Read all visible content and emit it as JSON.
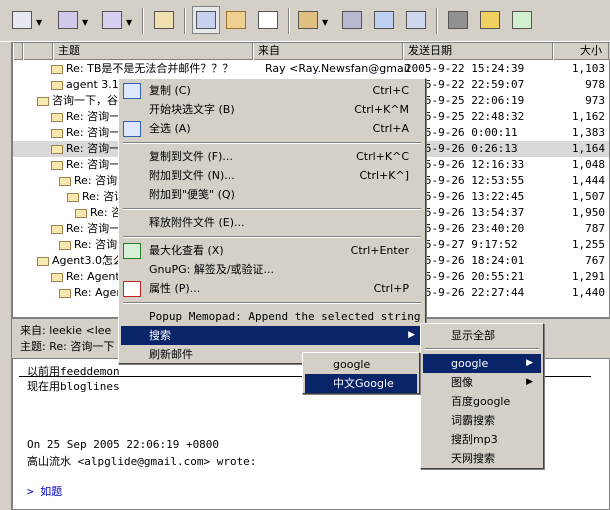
{
  "list": {
    "columns": [
      "主题",
      "来自",
      "发送日期",
      "大小"
    ],
    "rows": [
      {
        "subject": "Re: TB是不是无法合并邮件？？？",
        "from": "Ray <Ray.Newsfan@gmail...",
        "date": "2005-9-22 15:24:39",
        "size": "1,103"
      },
      {
        "subject": "agent 3.1 & ...",
        "from": "",
        "date": "2005-9-22 22:59:07",
        "size": "978"
      },
      {
        "subject": "咨询一下，谷...",
        "from": "",
        "date": "2005-9-25 22:06:19",
        "size": "973"
      },
      {
        "subject": "Re: 咨询一...",
        "from": "",
        "date": "2005-9-25 22:48:32",
        "size": "1,162"
      },
      {
        "subject": "Re: 咨询一...",
        "from": "",
        "date": "2005-9-26 0:00:11",
        "size": "1,383"
      },
      {
        "subject": "Re: 咨询一...",
        "from": "",
        "date": "2005-9-26 0:26:13",
        "size": "1,164"
      },
      {
        "subject": "Re: 咨询一...",
        "from": "",
        "date": "2005-9-26 12:16:33",
        "size": "1,048"
      },
      {
        "subject": "Re: 咨询...",
        "from": "",
        "date": "2005-9-26 12:53:55",
        "size": "1,444"
      },
      {
        "subject": "Re: 咨询...",
        "from": "",
        "date": "2005-9-26 13:22:45",
        "size": "1,507"
      },
      {
        "subject": "Re: 咨询...",
        "from": "",
        "date": "2005-9-26 13:54:37",
        "size": "1,950"
      },
      {
        "subject": "Re: 咨询一...",
        "from": "",
        "date": "2005-9-26 23:40:20",
        "size": "787"
      },
      {
        "subject": "Re: 咨询...",
        "from": "",
        "date": "2005-9-27 9:17:52",
        "size": "1,255"
      },
      {
        "subject": "Agent3.0怎么...",
        "from": "",
        "date": "2005-9-26 18:24:01",
        "size": "767"
      },
      {
        "subject": "Re: Agent3...",
        "from": "",
        "date": "2005-9-26 20:55:21",
        "size": "1,291"
      },
      {
        "subject": "Re: Agen...",
        "from": "",
        "date": "2005-9-26 22:27:44",
        "size": "1,440"
      }
    ]
  },
  "preview": {
    "from_line": "来自: leekie <lee",
    "subject_line": "主题: Re: 咨询一下",
    "body": [
      "以前用feeddemon",
      "现在用bloglines",
      "",
      "",
      "",
      "On 25 Sep 2005 22:06:19 +0800",
      "高山流水 <alpglide@gmail.com> wrote:",
      "",
      "> 如题"
    ]
  },
  "context_menu": {
    "items": [
      {
        "label": "复制 (C)",
        "shortcut": "Ctrl+C"
      },
      {
        "label": "开始块选文字 (B)",
        "shortcut": "Ctrl+K^M"
      },
      {
        "label": "全选 (A)",
        "shortcut": "Ctrl+A"
      },
      {
        "label": "复制到文件 (F)...",
        "shortcut": "Ctrl+K^C"
      },
      {
        "label": "附加到文件 (N)...",
        "shortcut": "Ctrl+K^]"
      },
      {
        "label": "附加到\"便笺\" (Q)",
        "shortcut": ""
      },
      {
        "label": "释放附件文件 (E)...",
        "shortcut": ""
      },
      {
        "label": "最大化查看 (X)",
        "shortcut": "Ctrl+Enter"
      },
      {
        "label": "GnuPG: 解签及/或验证...",
        "shortcut": ""
      },
      {
        "label": "属性 (P)...",
        "shortcut": "Ctrl+P"
      },
      {
        "label": "Popup Memopad: Append the selected string",
        "shortcut": ""
      },
      {
        "label": "搜索",
        "shortcut": ""
      },
      {
        "label": "刷新邮件",
        "shortcut": ""
      }
    ]
  },
  "search_menu": {
    "items": [
      "显示全部",
      "google",
      "图像",
      "百度google",
      "词霸搜索",
      "搜刮mp3",
      "天网搜索"
    ]
  },
  "google_menu": {
    "items": [
      "google",
      "中文Google"
    ]
  },
  "colors": {
    "highlight": "#0a246a",
    "menu_bg": "#d4d0c8"
  }
}
